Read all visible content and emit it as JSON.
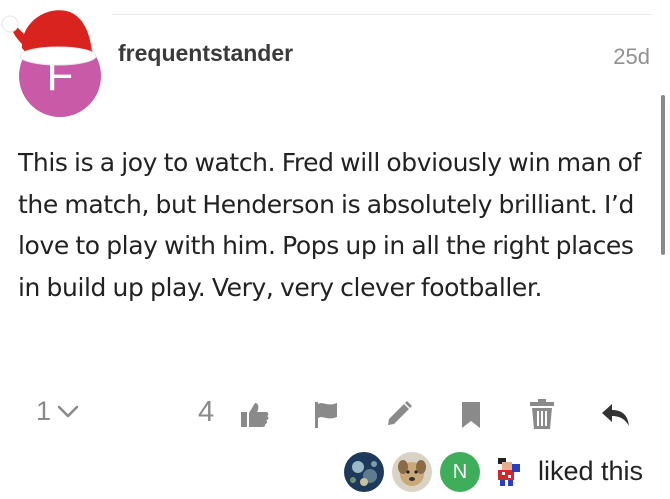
{
  "post": {
    "author": {
      "username": "frequentstander",
      "avatar_letter": "F",
      "avatar_color": "#c85aa8"
    },
    "date": "25d",
    "body": "This is a joy to watch. Fred will obviously win man of the match, but Henderson is absolutely brilliant. I’d love to play with him. Pops up in all the right places in build up play. Very, very clever footballer."
  },
  "actions": {
    "reply_count": "1",
    "like_count": "4"
  },
  "likers": {
    "avatars": [
      "avatar-photo-1",
      "avatar-photo-dog",
      "N",
      "avatar-pixel-character"
    ],
    "n_avatar_color": "#3fae5a",
    "text": "liked this"
  },
  "colors": {
    "icon": "#8a8a8a",
    "reply_icon": "#333333",
    "text": "#222222"
  }
}
